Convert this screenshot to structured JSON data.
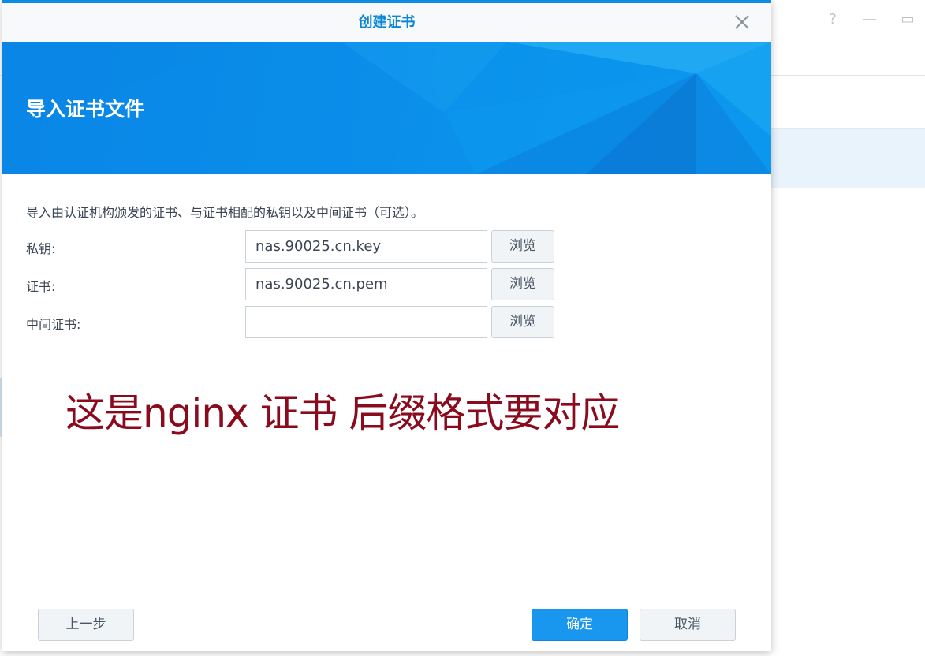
{
  "background_window": {
    "controls": [
      {
        "name": "help-icon",
        "glyph": "?"
      },
      {
        "name": "minimize-icon",
        "glyph": "—"
      },
      {
        "name": "maximize-icon",
        "glyph": "▭"
      }
    ]
  },
  "dialog": {
    "title": "创建证书",
    "close_icon": "close-icon",
    "banner_title": "导入证书文件",
    "description": "导入由认证机构颁发的证书、与证书相配的私钥以及中间证书（可选）。",
    "fields": [
      {
        "label": "私钥:",
        "value": "nas.90025.cn.key",
        "browse_label": "浏览"
      },
      {
        "label": "证书:",
        "value": "nas.90025.cn.pem",
        "browse_label": "浏览"
      },
      {
        "label": "中间证书:",
        "value": "",
        "browse_label": "浏览"
      }
    ],
    "annotation": "这是nginx 证书 后缀格式要对应",
    "buttons": {
      "prev": "上一步",
      "ok": "确定",
      "cancel": "取消"
    }
  },
  "colors": {
    "accent": "#0b86d7",
    "banner": "#0a8eea",
    "primary_button": "#1996ee",
    "annotation": "#8b0b1e"
  }
}
